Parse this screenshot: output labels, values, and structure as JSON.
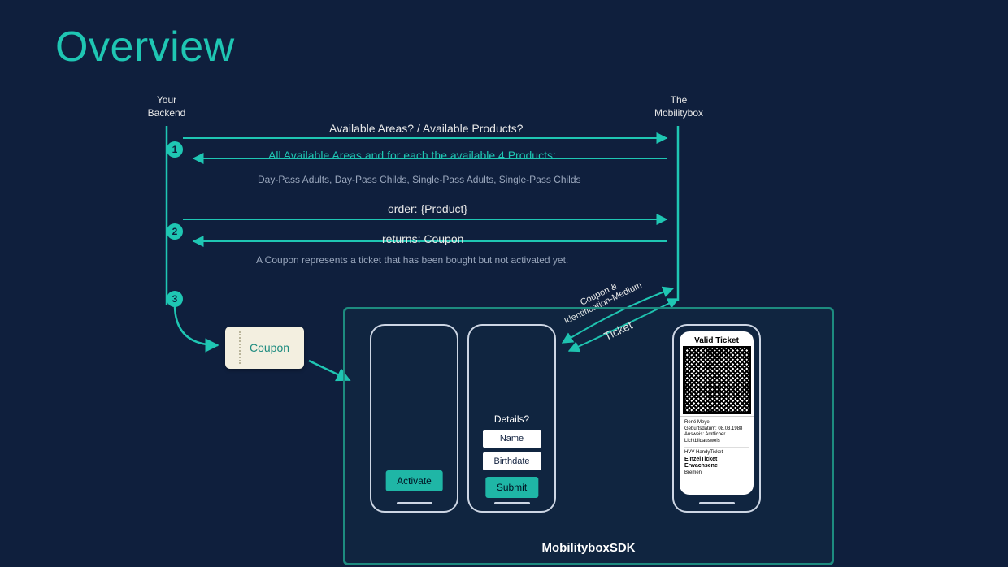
{
  "title": "Overview",
  "actors": {
    "left": "Your\nBackend",
    "right": "The\nMobilitybox"
  },
  "steps": [
    "1",
    "2",
    "3"
  ],
  "flow": {
    "q1": "Available Areas? / Available Products?",
    "a1": "All Available Areas and for each the available 4 Products:",
    "a1sub": "Day-Pass Adults, Day-Pass Childs, Single-Pass Adults, Single-Pass Childs",
    "q2": "order: {Product}",
    "a2": "returns: Coupon",
    "a2sub": "A Coupon represents a ticket that has been bought but not activated yet."
  },
  "coupon_label": "Coupon",
  "sdk": {
    "title": "MobilityboxSDK",
    "activate": "Activate",
    "details_q": "Details?",
    "name_field": "Name",
    "birth_field": "Birthdate",
    "submit": "Submit",
    "ticket_title": "Valid Ticket",
    "ticket_name": "René Meye",
    "ticket_dob": "Geburtsdatum: 08.03.1988",
    "ticket_aux": "Ausweis: Amtlicher Lichtbildausweis",
    "ticket_prod_line": "HVV-HandyTicket",
    "ticket_prod": "EinzelTicket Erwachsene",
    "ticket_area": "Bremen"
  },
  "exchange": {
    "up": "Coupon &\nIdentification-Medium",
    "down": "Ticket"
  }
}
